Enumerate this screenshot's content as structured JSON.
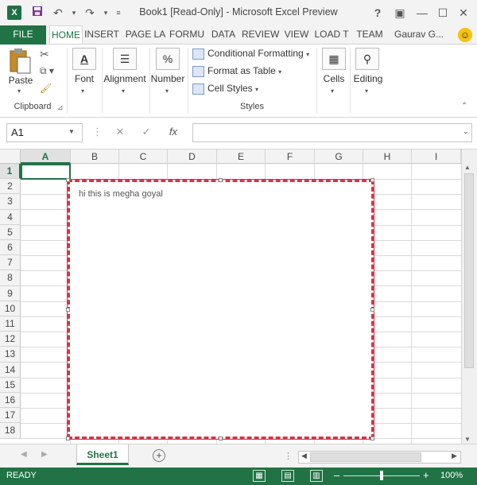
{
  "window": {
    "title": "Book1  [Read-Only] - Microsoft Excel Preview",
    "quick_access": {
      "save_icon": "save-icon",
      "undo_icon": "undo-icon",
      "redo_icon": "redo-icon"
    },
    "controls": {
      "help": "?",
      "restore_ribbon": "▣",
      "minimize": "—",
      "maximize": "☐",
      "close": "✕"
    }
  },
  "tabs": {
    "file": "FILE",
    "items": [
      "HOME",
      "INSERT",
      "PAGE LA",
      "FORMU",
      "DATA",
      "REVIEW",
      "VIEW",
      "LOAD T",
      "TEAM"
    ],
    "user": "Gaurav G...",
    "active": "HOME"
  },
  "ribbon": {
    "clipboard": {
      "paste": "Paste",
      "label": "Clipboard"
    },
    "font": "Font",
    "alignment": "Alignment",
    "number": "Number",
    "styles": {
      "conditional": "Conditional Formatting",
      "format_table": "Format as Table",
      "cell_styles": "Cell Styles",
      "label": "Styles"
    },
    "cells": "Cells",
    "editing": "Editing"
  },
  "formula_bar": {
    "name_box": "A1",
    "fx": "fx",
    "value": ""
  },
  "grid": {
    "columns": [
      "A",
      "B",
      "C",
      "D",
      "E",
      "F",
      "G",
      "H",
      "I"
    ],
    "rows": [
      "1",
      "2",
      "3",
      "4",
      "5",
      "6",
      "7",
      "8",
      "9",
      "10",
      "11",
      "12",
      "13",
      "14",
      "15",
      "16",
      "17",
      "18"
    ],
    "selected_cell": "A1"
  },
  "textbox": {
    "text": "hi this is megha goyal",
    "border_color": "#d63447"
  },
  "sheets": {
    "tabs": [
      "Sheet1"
    ],
    "active": "Sheet1",
    "add": "+"
  },
  "status": {
    "text": "READY",
    "zoom": "100%"
  },
  "colors": {
    "accent": "#217346"
  }
}
